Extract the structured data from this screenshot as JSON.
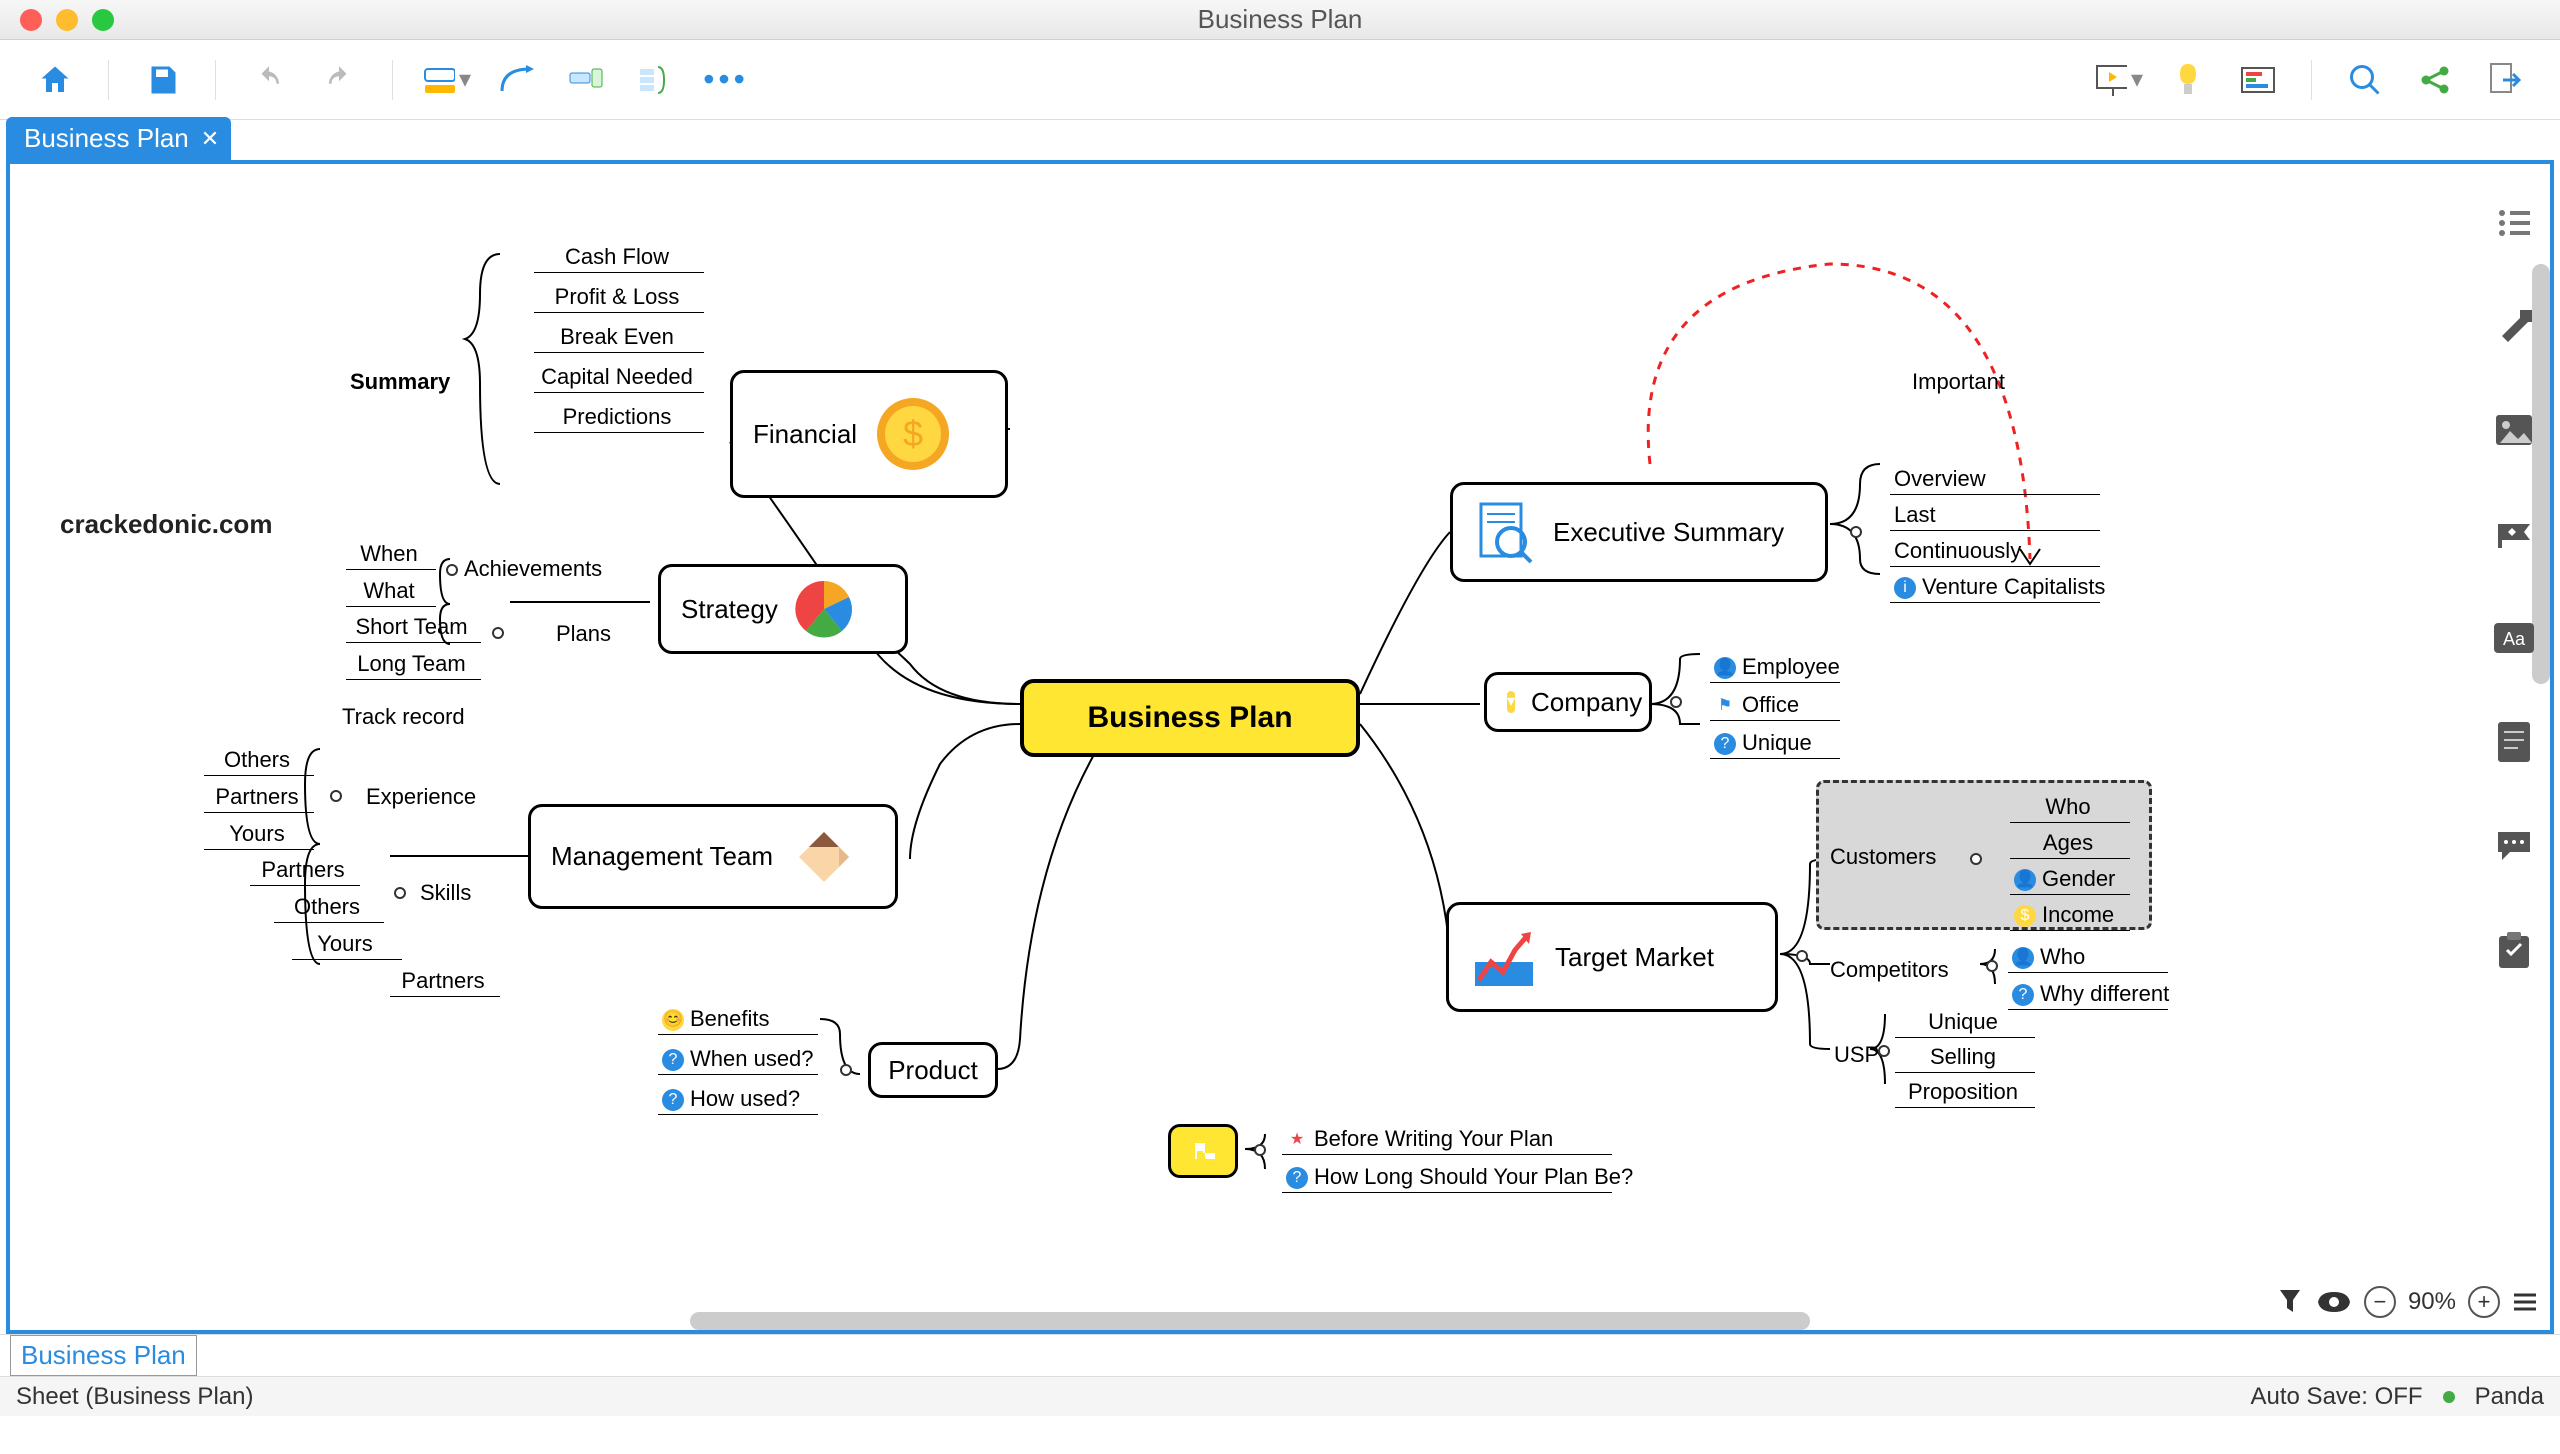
{
  "window": {
    "title": "Business Plan"
  },
  "tab": {
    "label": "Business Plan"
  },
  "sheet_tab": {
    "label": "Business Plan"
  },
  "statusbar": {
    "sheet": "Sheet (Business Plan)",
    "autosave": "Auto Save: OFF",
    "user": "Panda"
  },
  "zoom": {
    "level": "90%"
  },
  "watermark": "crackedonic.com",
  "map": {
    "center": "Business Plan",
    "financial": {
      "label": "Financial",
      "summary": "Summary",
      "items": [
        "Cash Flow",
        "Profit & Loss",
        "Break Even",
        "Capital Needed",
        "Predictions"
      ]
    },
    "strategy": {
      "label": "Strategy",
      "achievements": "Achievements",
      "plans": "Plans",
      "ach_items": [
        "When",
        "What"
      ],
      "plan_items": [
        "Short Team",
        "Long Team"
      ]
    },
    "management": {
      "label": "Management Team",
      "track": "Track record",
      "exp": "Experience",
      "skills": "Skills",
      "exp_items": [
        "Others",
        "Partners",
        "Yours"
      ],
      "sk_items": [
        "Partners",
        "Others",
        "Yours",
        "Partners"
      ]
    },
    "product": {
      "label": "Product",
      "items": [
        "Benefits",
        "When used?",
        "How used?"
      ]
    },
    "executive": {
      "label": "Executive Summary",
      "items": [
        "Overview",
        "Last",
        "Continuously",
        "Venture Capitalists"
      ],
      "important": "Important"
    },
    "company": {
      "label": "Company",
      "items": [
        "Employee",
        "Office",
        "Unique"
      ]
    },
    "target": {
      "label": "Target Market",
      "customers": "Customers",
      "competitors": "Competitors",
      "usp": "USP",
      "cust_items": [
        "Who",
        "Ages",
        "Gender",
        "Income"
      ],
      "comp_items": [
        "Who",
        "Why different"
      ],
      "usp_items": [
        "Unique",
        "Selling",
        "Proposition"
      ]
    },
    "floating": {
      "items": [
        "Before Writing Your Plan",
        "How Long Should Your Plan Be?"
      ]
    }
  }
}
